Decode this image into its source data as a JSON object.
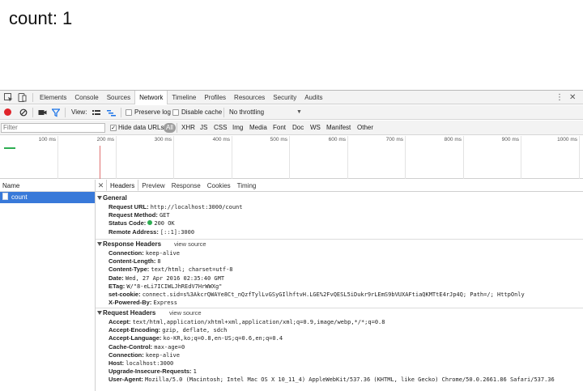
{
  "page": {
    "count_text": "count: 1"
  },
  "devtools": {
    "tabs": [
      "Elements",
      "Console",
      "Sources",
      "Network",
      "Timeline",
      "Profiles",
      "Resources",
      "Security",
      "Audits"
    ],
    "active_tab": "Network",
    "network_toolbar": {
      "view_label": "View:",
      "preserve_log": "Preserve log",
      "disable_cache": "Disable cache",
      "throttling": "No throttling"
    },
    "filter_bar": {
      "placeholder": "Filter",
      "hide_data_urls": "Hide data URLs",
      "types": [
        "All",
        "XHR",
        "JS",
        "CSS",
        "Img",
        "Media",
        "Font",
        "Doc",
        "WS",
        "Manifest",
        "Other"
      ]
    },
    "timeline_ticks": [
      "100 ms",
      "200 ms",
      "300 ms",
      "400 ms",
      "500 ms",
      "600 ms",
      "700 ms",
      "800 ms",
      "900 ms",
      "1000 ms"
    ],
    "request_list": {
      "header": "Name",
      "items": [
        "count"
      ]
    },
    "detail_tabs": [
      "Headers",
      "Preview",
      "Response",
      "Cookies",
      "Timing"
    ],
    "active_detail_tab": "Headers",
    "general": {
      "title": "General",
      "rows": [
        {
          "key": "Request URL:",
          "value": "http://localhost:3000/count"
        },
        {
          "key": "Request Method:",
          "value": "GET"
        },
        {
          "key": "Status Code:",
          "value": "200 OK"
        },
        {
          "key": "Remote Address:",
          "value": "[::1]:3000"
        }
      ]
    },
    "response_headers": {
      "title": "Response Headers",
      "view_source": "view source",
      "rows": [
        {
          "key": "Connection:",
          "value": "keep-alive"
        },
        {
          "key": "Content-Length:",
          "value": "8"
        },
        {
          "key": "Content-Type:",
          "value": "text/html; charset=utf-8"
        },
        {
          "key": "Date:",
          "value": "Wed, 27 Apr 2016 02:35:40 GMT"
        },
        {
          "key": "ETag:",
          "value": "W/\"8-eLi7ICIWLJhREdV7HrWWXg\""
        },
        {
          "key": "set-cookie:",
          "value": "connect.sid=s%3AkcrQWAYe8Ct_nQzfTylLvGSyGIlhftvH.LGE%2FvQESL5iDukr9rLEmS9bVUXAFtiaQKMTtE4rJp4Q; Path=/; HttpOnly"
        },
        {
          "key": "X-Powered-By:",
          "value": "Express"
        }
      ]
    },
    "request_headers": {
      "title": "Request Headers",
      "view_source": "view source",
      "rows": [
        {
          "key": "Accept:",
          "value": "text/html,application/xhtml+xml,application/xml;q=0.9,image/webp,*/*;q=0.8"
        },
        {
          "key": "Accept-Encoding:",
          "value": "gzip, deflate, sdch"
        },
        {
          "key": "Accept-Language:",
          "value": "ko-KR,ko;q=0.8,en-US;q=0.6,en;q=0.4"
        },
        {
          "key": "Cache-Control:",
          "value": "max-age=0"
        },
        {
          "key": "Connection:",
          "value": "keep-alive"
        },
        {
          "key": "Host:",
          "value": "localhost:3000"
        },
        {
          "key": "Upgrade-Insecure-Requests:",
          "value": "1"
        },
        {
          "key": "User-Agent:",
          "value": "Mozilla/5.0 (Macintosh; Intel Mac OS X 10_11_4) AppleWebKit/537.36 (KHTML, like Gecko) Chrome/50.0.2661.86 Safari/537.36"
        }
      ]
    },
    "colors": {
      "record": "#e0242a",
      "selected_row": "#3879d9",
      "status_ok": "#2eae52",
      "filter_active": "#1a73e8"
    }
  }
}
